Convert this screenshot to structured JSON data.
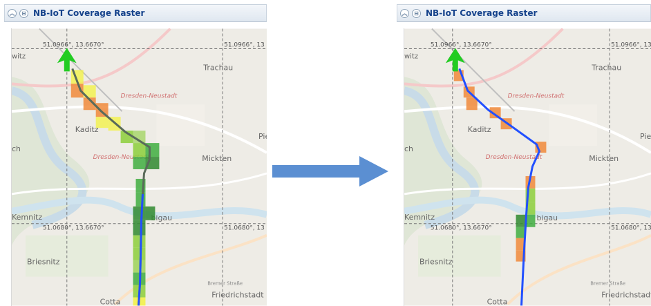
{
  "colors": {
    "title_text": "#15428b",
    "route": "#2250ff",
    "route_grey": "#5a6b5a",
    "arrow": "#5b8fd2",
    "north_arrow": "#22cc22",
    "coverage_orange": "#f08a3a",
    "coverage_yellow": "#f2f24a",
    "coverage_light_green": "#8ccf3a",
    "coverage_green": "#3fae3f",
    "coverage_dark_green": "#2f8a2f"
  },
  "left_panel": {
    "title": "NB-IoT Coverage Raster",
    "collapse_icon": "double-chevron-up-icon",
    "pin_icon": "pin-icon",
    "map": {
      "coord_top_left": "51.0966°, 13.6670°",
      "coord_top_right": "51.0966°, 13",
      "coord_bottom_left": "51.0680°, 13.6670°",
      "coord_bottom_right": "51.0680°, 13",
      "place_trachau": "Trachau",
      "place_dresden_neustadt": "Dresden-Neustadt",
      "place_kaditz": "Kaditz",
      "place_dresden_neustadt_2": "Dresden-Neustadt",
      "place_mickten": "Mickten",
      "place_pieschen": "Pie",
      "place_ubigau": "bigau",
      "place_kemnitz": "Kemnitz",
      "place_briesnitz": "Briesnitz",
      "place_cotta": "Cotta",
      "place_friedrichstadt": "Friedrichstadt",
      "street_bremer": "Bremer Straße",
      "edge_witz": "witz",
      "edge_ch": "ch"
    }
  },
  "right_panel": {
    "title": "NB-IoT Coverage Raster",
    "collapse_icon": "double-chevron-up-icon",
    "pin_icon": "pin-icon",
    "map": {
      "coord_top_left": "51.0966°, 13.6670°",
      "coord_top_right": "51.0966°, 13",
      "coord_bottom_left": "51.0680°, 13.6670°",
      "coord_bottom_right": "51.0680°, 13",
      "place_trachau": "Trachau",
      "place_dresden_neustadt": "Dresden-Neustadt",
      "place_kaditz": "Kaditz",
      "place_dresden_neustadt_2": "Dresden-Neustadt",
      "place_mickten": "Mickten",
      "place_pieschen": "Pie",
      "place_ubigau": "bigau",
      "place_kemnitz": "Kemnitz",
      "place_briesnitz": "Briesnitz",
      "place_cotta": "Cotta",
      "place_friedrichstadt": "Friedrichstadt",
      "street_bremer": "Bremer Straße",
      "edge_witz": "witz",
      "edge_ch": "ch"
    }
  },
  "transition_arrow_icon": "right-arrow-icon"
}
